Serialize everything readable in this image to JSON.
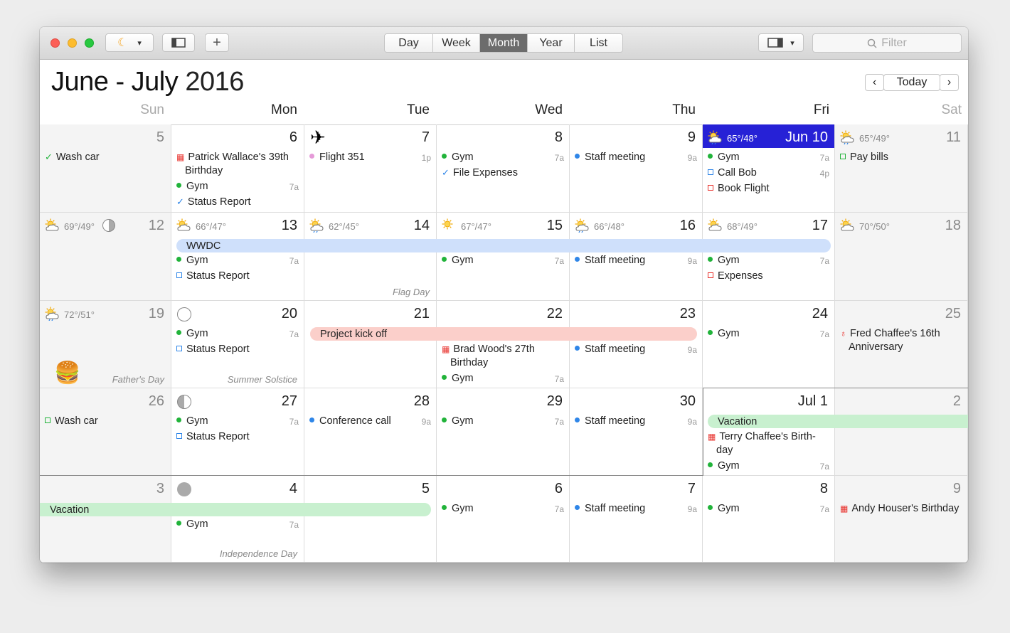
{
  "toolbar": {
    "views": [
      "Day",
      "Week",
      "Month",
      "Year",
      "List"
    ],
    "active_view": "Month",
    "filter_placeholder": "Filter",
    "add_label": "+"
  },
  "header": {
    "title_month": "June - July",
    "title_year": "2016",
    "today_label": "Today"
  },
  "days_of_week": [
    "Sun",
    "Mon",
    "Tue",
    "Wed",
    "Thu",
    "Fri",
    "Sat"
  ],
  "weeks": [
    [
      "5",
      "6",
      "7",
      "8",
      "9",
      "Jun 10",
      "11"
    ],
    [
      "12",
      "13",
      "14",
      "15",
      "16",
      "17",
      "18"
    ],
    [
      "19",
      "20",
      "21",
      "22",
      "23",
      "24",
      "25"
    ],
    [
      "26",
      "27",
      "28",
      "29",
      "30",
      "Jul 1",
      "2"
    ],
    [
      "3",
      "4",
      "5",
      "6",
      "7",
      "8",
      "9"
    ]
  ],
  "weather": {
    "w0d5": "65°/48°",
    "w0d6": "65°/49°",
    "w1d0": "69°/49°",
    "w1d1": "66°/47°",
    "w1d2": "62°/45°",
    "w1d3": "67°/47°",
    "w1d4": "66°/48°",
    "w1d5": "68°/49°",
    "w1d6": "70°/50°",
    "w2d0": "72°/51°"
  },
  "holidays": {
    "w1d2": "Flag Day",
    "w2d0": "Father's Day",
    "w2d1": "Summer Solstice",
    "w4d1": "Independence Day"
  },
  "events": {
    "wash_car": "Wash car",
    "patrick": "Patrick Wallace's 39th",
    "patrick2": "Birthday",
    "gym": "Gym",
    "status": "Status Report",
    "flight": "Flight 351",
    "file_exp": "File Expenses",
    "staff": "Staff meeting",
    "call_bob": "Call Bob",
    "book_flight": "Book Flight",
    "pay_bills": "Pay bills",
    "wwdc": "WWDC",
    "expenses": "Expenses",
    "project": "Project kick off",
    "brad": "Brad Wood's 27th",
    "brad2": "Birthday",
    "fred": "Fred Chaffee's 16th",
    "fred2": "Anniversary",
    "conference": "Conference call",
    "vacation": "Vacation",
    "terry": "Terry Chaffee's Birth-",
    "terry2": "day",
    "andy": "Andy Houser's Birthday"
  },
  "times": {
    "t7a": "7a",
    "t9a": "9a",
    "t1p": "1p",
    "t4p": "4p"
  },
  "colors": {
    "today_bg": "#2621d6",
    "gym": "#21b33a",
    "work": "#2f86e8",
    "personal": "#e8302b",
    "wwdc": "#cfe0fb",
    "project": "#fbcfca",
    "vacation": "#c8f0cf"
  }
}
